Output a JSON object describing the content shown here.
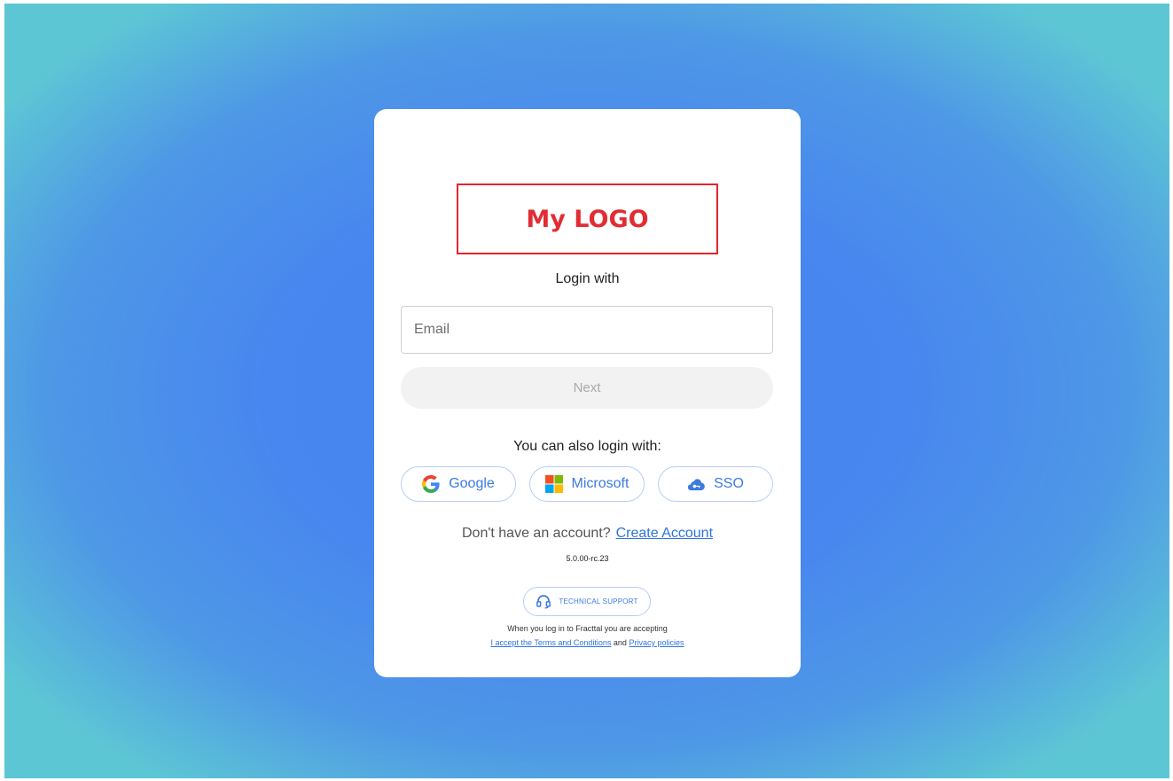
{
  "logo": {
    "text": "My LOGO"
  },
  "login": {
    "heading": "Login with",
    "email_placeholder": "Email",
    "next_label": "Next"
  },
  "alt_login": {
    "heading": "You can also login with:",
    "providers": [
      {
        "label": "Google",
        "icon": "google-icon"
      },
      {
        "label": "Microsoft",
        "icon": "microsoft-icon"
      },
      {
        "label": "SSO",
        "icon": "cloud-key-icon"
      }
    ]
  },
  "signup": {
    "prompt": "Don't have an account?",
    "link": "Create Account"
  },
  "version": "5.0.00-rc.23",
  "support": {
    "label": "TECHNICAL SUPPORT",
    "icon": "headset-icon"
  },
  "terms": {
    "line1": "When you log in to Fracttal you are accepting",
    "terms_link": "I accept the Terms and Conditions",
    "joiner": "and",
    "privacy_link": "Privacy policies"
  },
  "colors": {
    "accent": "#2f73e0",
    "logo_red": "#e22c33",
    "bg_center": "#4683ef",
    "bg_edge": "#5dc6d5"
  }
}
